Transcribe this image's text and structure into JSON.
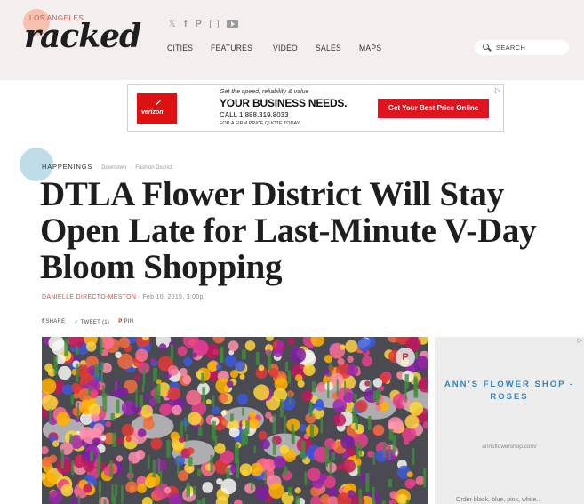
{
  "header": {
    "city": "LOS ANGELES",
    "logo": "racked",
    "nav": [
      "CITIES",
      "FEATURES",
      "VIDEO",
      "SALES",
      "MAPS"
    ],
    "search_placeholder": "SEARCH",
    "social_icons": [
      "twitter-icon",
      "facebook-icon",
      "pinterest-icon",
      "instagram-icon",
      "youtube-icon"
    ]
  },
  "ad": {
    "brand": "verizon",
    "line1": "Get the speed, reliability & value",
    "line2": "YOUR BUSINESS NEEDS.",
    "line3": "CALL 1.888.319.8033",
    "line4": "FOR A FIRM PRICE QUOTE TODAY.",
    "cta": "Get Your Best Price Online"
  },
  "article": {
    "breadcrumb_main": "HAPPENINGS",
    "breadcrumb_subs": [
      "Downtown",
      "Fashion District"
    ],
    "title": "DTLA Flower District Will Stay Open Late for Last-Minute V-Day Bloom Shopping",
    "author": "DANIELLE DIRECTO-MESTON",
    "date": "Feb 10, 2015, 3:00p",
    "share": {
      "facebook": "SHARE",
      "twitter": "TWEET (1)",
      "pinterest": "PIN"
    }
  },
  "sidebar_ad": {
    "title": "ANN'S FLOWER SHOP - ROSES",
    "url": "annsflowershop.com/",
    "desc": "Order black, blue, pink, white..."
  },
  "colors": {
    "accent": "#d4534a",
    "header_bg": "#f4efee",
    "link_blue": "#2f86c2"
  }
}
